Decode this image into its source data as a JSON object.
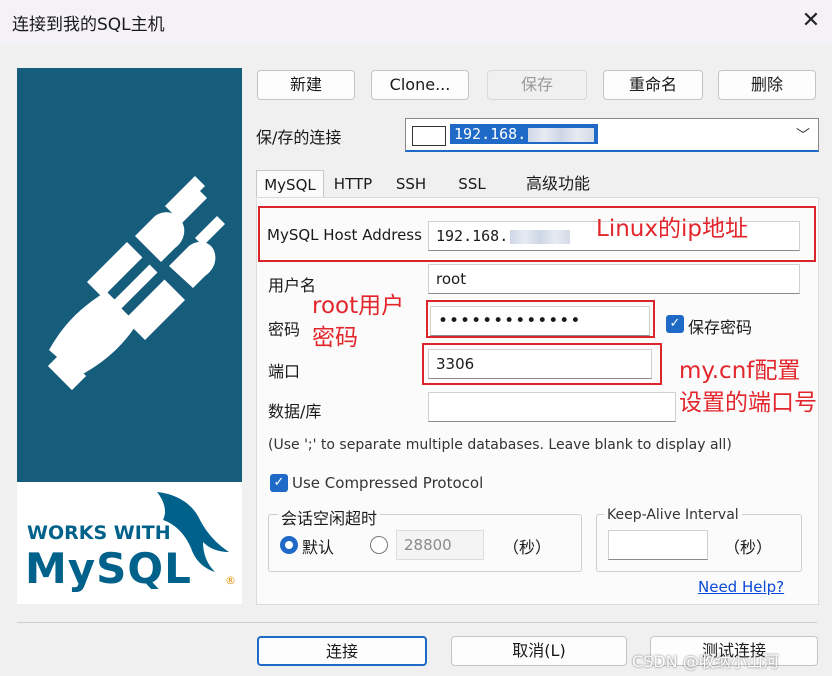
{
  "window": {
    "title": "连接到我的SQL主机",
    "close_glyph": "✕"
  },
  "toolbar": {
    "new": "新建",
    "clone": "Clone...",
    "save": "保存",
    "rename": "重命名",
    "delete": "删除"
  },
  "saved_connection": {
    "label": "保/存的连接",
    "value": "192.168."
  },
  "tabs": [
    {
      "label": "MySQL"
    },
    {
      "label": "HTTP"
    },
    {
      "label": "SSH"
    },
    {
      "label": "SSL"
    },
    {
      "label": "高级功能"
    }
  ],
  "form": {
    "host_label": "MySQL Host Address",
    "host_value": "192.168.",
    "user_label": "用户名",
    "user_value": "root",
    "password_label": "密码",
    "password_value": "•••••••••••••",
    "save_password_label": "保存密码",
    "port_label": "端口",
    "port_value": "3306",
    "database_label": "数据/库",
    "database_value": "",
    "database_hint": "(Use ';' to separate multiple databases. Leave blank to display all)",
    "compressed_label": "Use Compressed Protocol",
    "session_timeout_title": "会话空闲超时",
    "default_label": "默认",
    "timeout_value": "28800",
    "seconds_label": "（秒）",
    "keepalive_title": "Keep-Alive Interval",
    "keepalive_value": "",
    "keepalive_seconds_label": "（秒）",
    "help_link": "Need Help?"
  },
  "annotations": {
    "host": "Linux的ip地址",
    "password_line1": "root用户",
    "password_line2": "密码",
    "port_line1": "my.cnf配置",
    "port_line2": "设置的端口号"
  },
  "footer": {
    "connect": "连接",
    "cancel": "取消(L)",
    "test": "测试连接"
  },
  "banner": {
    "works_with": "WORKS WITH",
    "brand": "MySQL",
    "registered": "®"
  },
  "watermark": "CSDN @收纳小山河",
  "colors": {
    "banner": "#165d7c",
    "accent": "#1f6ac6",
    "annotation_red": "#e2262c",
    "mysql_blue": "#00618a",
    "mysql_orange": "#e48e00"
  }
}
